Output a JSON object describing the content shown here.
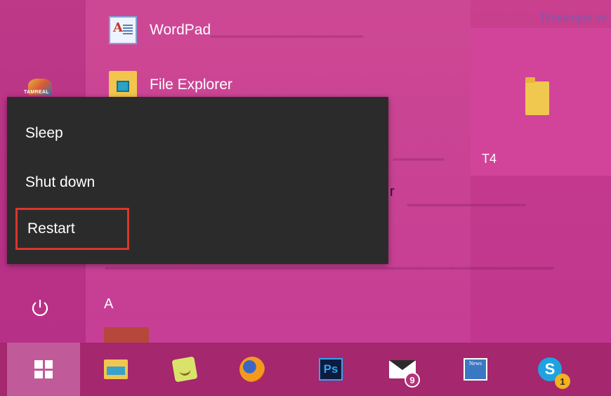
{
  "start_menu": {
    "apps": [
      {
        "label": "WordPad",
        "icon": "wordpad-icon"
      },
      {
        "label": "File Explorer",
        "icon": "file-explorer-icon"
      }
    ],
    "section_letter": "A",
    "watermark": "Taimienphi.vn",
    "tile": {
      "label": "T4",
      "icon": "folder-icon"
    },
    "power_button_icon": "power-icon"
  },
  "power_menu": {
    "items": [
      {
        "label": "Sleep"
      },
      {
        "label": "Shut down"
      },
      {
        "label": "Restart",
        "highlighted": true
      }
    ],
    "highlight_color": "#d8362d"
  },
  "taskbar": {
    "start_icon": "windows-logo-icon",
    "apps": [
      {
        "name": "file-explorer",
        "icon": "folder-icon"
      },
      {
        "name": "sticky-notes",
        "icon": "sticky-notes-icon"
      },
      {
        "name": "firefox",
        "icon": "firefox-icon"
      },
      {
        "name": "photoshop",
        "icon": "photoshop-icon",
        "text": "Ps"
      },
      {
        "name": "mail",
        "icon": "mail-icon",
        "badge": "9"
      },
      {
        "name": "news",
        "icon": "news-icon",
        "text": "News"
      },
      {
        "name": "skype",
        "icon": "skype-icon",
        "text": "S",
        "badge": "1"
      }
    ],
    "background": "#a5276d"
  },
  "colors": {
    "start_background": "#c43d8f",
    "flyout_background": "#2b2b2b"
  }
}
